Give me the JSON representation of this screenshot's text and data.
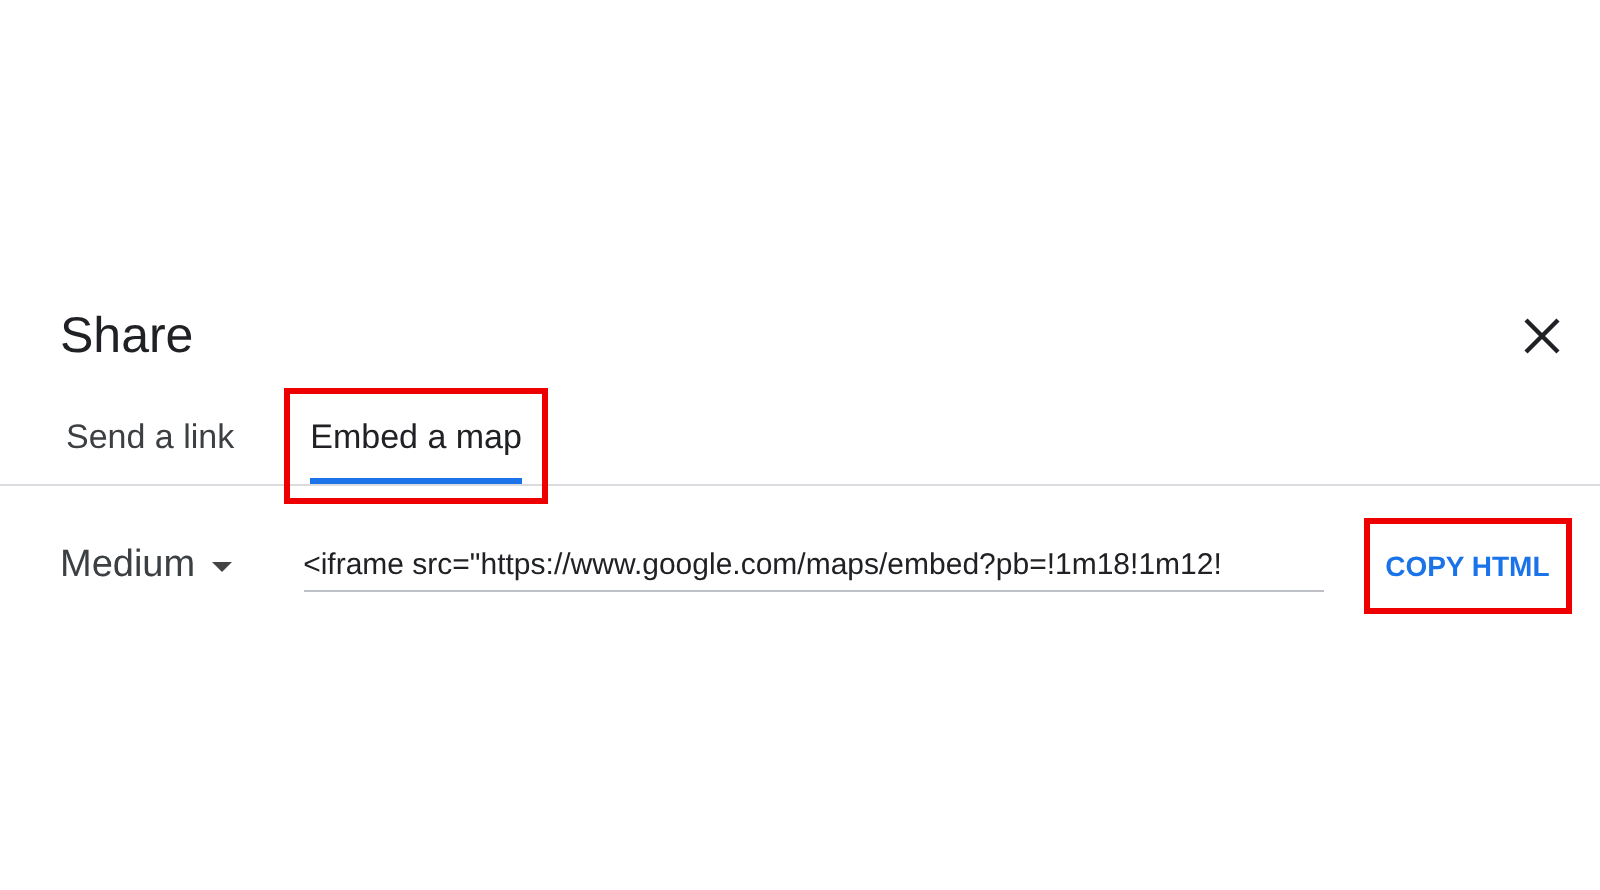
{
  "dialog": {
    "title": "Share"
  },
  "tabs": [
    {
      "label": "Send a link",
      "selected": false,
      "highlighted": false
    },
    {
      "label": "Embed a map",
      "selected": true,
      "highlighted": true
    }
  ],
  "size_select": {
    "value": "Medium"
  },
  "embed_field": {
    "value": "<iframe src=\"https://www.google.com/maps/embed?pb=!1m18!1m12!"
  },
  "copy_button": {
    "label": "COPY HTML",
    "highlighted": true
  }
}
